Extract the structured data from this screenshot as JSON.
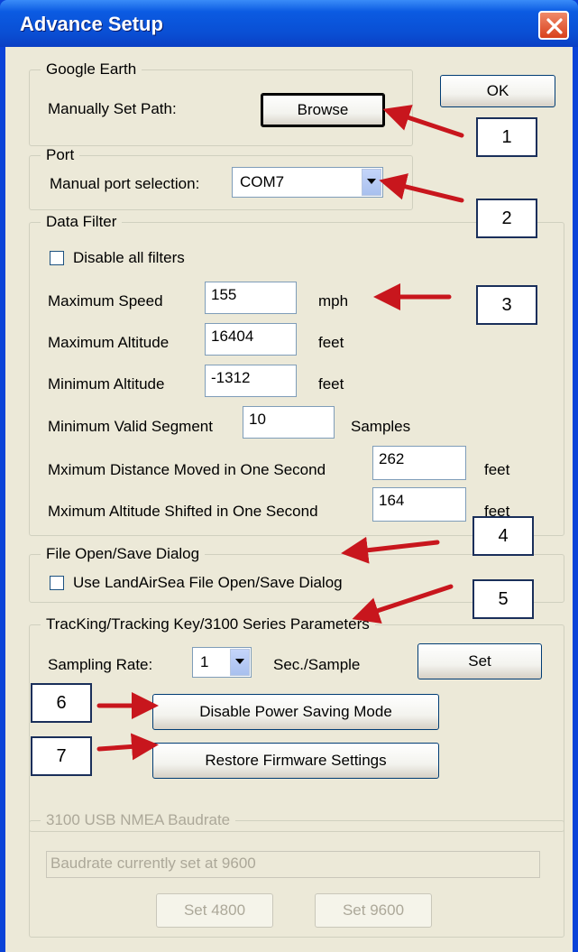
{
  "window": {
    "title": "Advance Setup"
  },
  "google_earth": {
    "legend": "Google Earth",
    "label": "Manually Set Path:",
    "browse_button": "Browse"
  },
  "ok_button": "OK",
  "port": {
    "legend": "Port",
    "label": "Manual port selection:",
    "selected": "COM7"
  },
  "data_filter": {
    "legend": "Data Filter",
    "disable_all_label": "Disable all filters",
    "disable_all_checked": false,
    "rows": [
      {
        "label": "Maximum Speed",
        "value": "155",
        "unit": "mph"
      },
      {
        "label": "Maximum Altitude",
        "value": "16404",
        "unit": "feet"
      },
      {
        "label": "Minimum Altitude",
        "value": "-1312",
        "unit": "feet"
      },
      {
        "label": "Minimum Valid Segment",
        "value": "10",
        "unit": "Samples"
      },
      {
        "label": "Mximum Distance Moved in One Second",
        "value": "262",
        "unit": "feet"
      },
      {
        "label": "Mximum Altitude Shifted in One Second",
        "value": "164",
        "unit": "feet"
      }
    ]
  },
  "file_dialog": {
    "legend": "File Open/Save Dialog",
    "checkbox_label": "Use LandAirSea File Open/Save Dialog",
    "checked": false
  },
  "tracking": {
    "legend": "TracKing/Tracking Key/3100 Series Parameters",
    "sampling_label": "Sampling Rate:",
    "sampling_value": "1",
    "sampling_unit": "Sec./Sample",
    "set_button": "Set",
    "disable_power_button": "Disable Power Saving Mode",
    "restore_button": "Restore Firmware Settings"
  },
  "baudrate": {
    "legend": "3100 USB NMEA Baudrate",
    "status": "Baudrate currently set at 9600",
    "set4800_button": "Set 4800",
    "set9600_button": "Set 9600"
  },
  "annotations": [
    "1",
    "2",
    "3",
    "4",
    "5",
    "6",
    "7"
  ],
  "colors": {
    "titlebar": "#0a4fd4",
    "dialog_bg": "#ece9d8",
    "arrow": "#c8161d",
    "disabled_text": "#aca899"
  }
}
